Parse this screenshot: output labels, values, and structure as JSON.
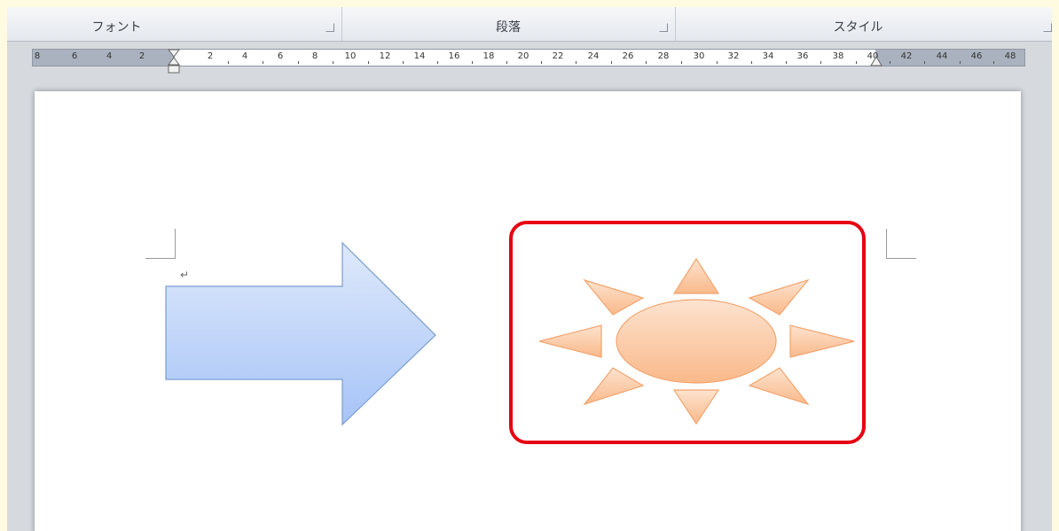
{
  "ribbon": {
    "groups": [
      {
        "label": "フォント"
      },
      {
        "label": "段落"
      },
      {
        "label": "スタイル"
      }
    ]
  },
  "ruler": {
    "labels": [
      "8",
      "6",
      "4",
      "2",
      "2",
      "4",
      "6",
      "8",
      "10",
      "12",
      "14",
      "16",
      "18",
      "20",
      "22",
      "24",
      "26",
      "28",
      "30",
      "32",
      "34",
      "36",
      "38",
      "40",
      "42",
      "44",
      "46",
      "48"
    ]
  },
  "document": {
    "paragraph_mark": "↵"
  },
  "shapes": {
    "arrow": {
      "icon": "block-arrow-right",
      "fill_top": "#dfe9fb",
      "fill_bottom": "#a6c4f7",
      "stroke": "#7a9dd0"
    },
    "sun": {
      "icon": "sun-shape",
      "fill_light": "#fde3cf",
      "fill_dark": "#f9b98a",
      "stroke": "#f3a46e"
    },
    "highlight_color": "#e60012"
  }
}
